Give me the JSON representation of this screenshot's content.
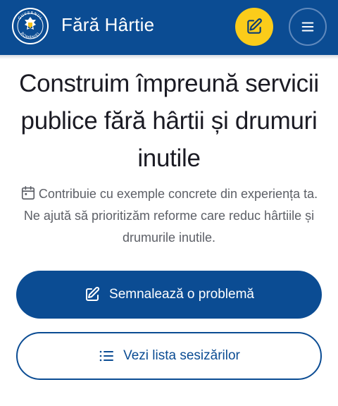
{
  "header": {
    "logo_text": "GUVERNUL ROMÂNIEI",
    "title": "Fără Hârtie",
    "edit_icon": "pencil-square-icon",
    "menu_icon": "hamburger-icon"
  },
  "hero": {
    "title": "Construim împreună servicii publice fără hârtii și drumuri inutile",
    "description": "Contribuie cu exemple concrete din experiența ta. Ne ajută să prioritizăm reforme care reduc hârtiile și drumurile inutile.",
    "description_icon": "calendar-icon"
  },
  "actions": {
    "report_label": "Semnalează o problemă",
    "report_icon": "pencil-square-icon",
    "list_label": "Vezi lista sesizărilor",
    "list_icon": "list-icon"
  },
  "colors": {
    "brand": "#0b4c93",
    "accent": "#fbcc1a"
  }
}
